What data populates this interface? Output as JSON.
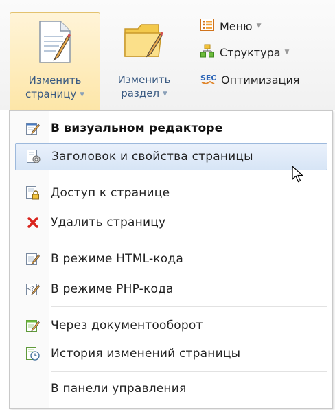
{
  "toolbar": {
    "edit_page": {
      "line1": "Изменить",
      "line2": "страницу",
      "caret": "▼"
    },
    "edit_section": {
      "line1": "Изменить",
      "line2": "раздел",
      "caret": "▼"
    },
    "menu": {
      "label": "Меню",
      "caret": "▼",
      "icon": "menu-list-icon"
    },
    "structure": {
      "label": "Структура",
      "caret": "▼",
      "icon": "structure-icon"
    },
    "seo": {
      "label": "Оптимизация",
      "icon": "seo-icon"
    }
  },
  "dropdown": {
    "items": [
      {
        "label": "В визуальном редакторе",
        "icon": "visual-editor-icon",
        "bold": true
      },
      {
        "label": "Заголовок и свойства страницы",
        "icon": "page-properties-icon",
        "hover": true
      },
      {
        "label": "Доступ к странице",
        "icon": "page-access-icon"
      },
      {
        "label": "Удалить страницу",
        "icon": "delete-icon"
      },
      {
        "label": "В режиме HTML-кода",
        "icon": "html-edit-icon"
      },
      {
        "label": "В режиме PHP-кода",
        "icon": "php-edit-icon"
      },
      {
        "label": "Через документооборот",
        "icon": "workflow-icon"
      },
      {
        "label": "История изменений страницы",
        "icon": "history-icon"
      },
      {
        "label": "В панели управления",
        "icon": ""
      }
    ]
  },
  "colors": {
    "accent_label": "#3a5a82",
    "active_button": "#fde6a8",
    "hover_item": "#d7e5f6",
    "delete_icon": "#d9231c"
  }
}
